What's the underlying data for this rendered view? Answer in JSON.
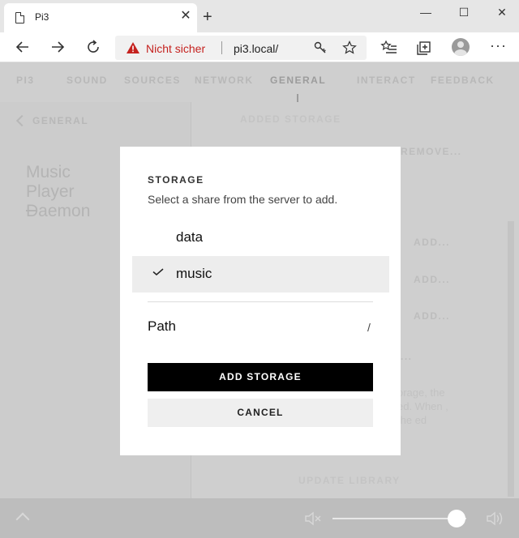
{
  "browser": {
    "tab_title": "Pi3",
    "tab_close": "✕",
    "new_tab": "+",
    "window_minimize": "—",
    "window_maximize": "☐",
    "window_close": "✕",
    "security_label": "Nicht sicher",
    "url": "pi3.local/",
    "more_menu": "···"
  },
  "page": {
    "nav": [
      "PI3",
      "SOUND",
      "SOURCES",
      "NETWORK",
      "GENERAL",
      "INTERACT",
      "FEEDBACK"
    ],
    "active_nav": "GENERAL",
    "back_label": "GENERAL",
    "section_title": "Music Player Daemon",
    "right_heading": "ADDED STORAGE",
    "remove_link": "REMOVE...",
    "add_links": [
      "ADD...",
      "ADD...",
      "ADD..."
    ],
    "ellipsis_link": "...",
    "background_text": "orage, the ed. When , the ed",
    "update_library": "UPDATE LIBRARY"
  },
  "modal": {
    "title": "STORAGE",
    "subtitle": "Select a share from the server to add.",
    "options": [
      {
        "label": "data",
        "selected": false
      },
      {
        "label": "music",
        "selected": true
      }
    ],
    "path_label": "Path",
    "path_value": "/",
    "add_button": "ADD STORAGE",
    "cancel_button": "CANCEL"
  },
  "player": {
    "volume_fraction": 0.93
  },
  "colors": {
    "accent_black": "#000000",
    "warning_red": "#c5221f",
    "overlay_gray": "#cfcfcf"
  }
}
